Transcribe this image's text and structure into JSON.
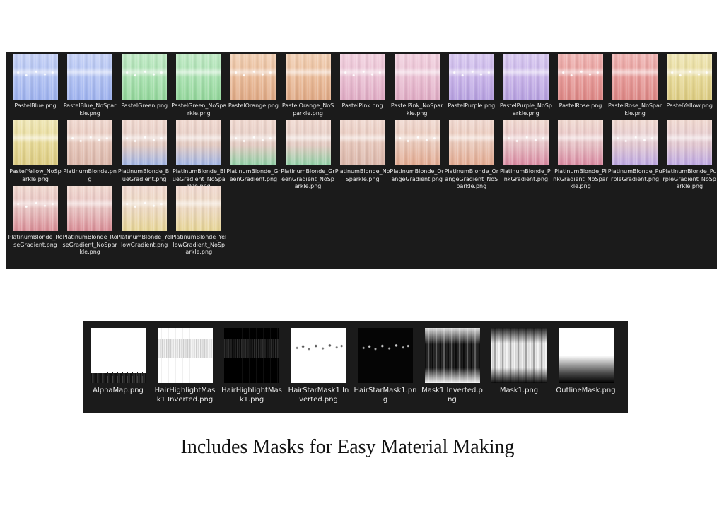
{
  "textures": [
    {
      "label": "PastelBlue.png",
      "colors": [
        "#c5d1f6",
        "#aebff2",
        "#9db1ee"
      ],
      "sparkle": true
    },
    {
      "label": "PastelBlue_NoSparkle.png",
      "colors": [
        "#c5d1f6",
        "#aebff2",
        "#9db1ee"
      ],
      "sparkle": false
    },
    {
      "label": "PastelGreen.png",
      "colors": [
        "#bfe9c4",
        "#a6e0ad",
        "#92d69a"
      ],
      "sparkle": true
    },
    {
      "label": "PastelGreen_NoSparkle.png",
      "colors": [
        "#bfe9c4",
        "#a6e0ad",
        "#92d69a"
      ],
      "sparkle": false
    },
    {
      "label": "PastelOrange.png",
      "colors": [
        "#f1cfb3",
        "#e9b996",
        "#dfa884"
      ],
      "sparkle": true
    },
    {
      "label": "PastelOrange_NoSparkle.png",
      "colors": [
        "#f1cfb3",
        "#e9b996",
        "#dfa884"
      ],
      "sparkle": false
    },
    {
      "label": "PastelPink.png",
      "colors": [
        "#f1d0de",
        "#e9bdd1",
        "#dfaac3"
      ],
      "sparkle": true
    },
    {
      "label": "PastelPink_NoSparkle.png",
      "colors": [
        "#f1d0de",
        "#e9bdd1",
        "#dfaac3"
      ],
      "sparkle": false
    },
    {
      "label": "PastelPurple.png",
      "colors": [
        "#d8c8f0",
        "#c6b1e8",
        "#b59fdf"
      ],
      "sparkle": true
    },
    {
      "label": "PastelPurple_NoSparkle.png",
      "colors": [
        "#d8c8f0",
        "#c6b1e8",
        "#b59fdf"
      ],
      "sparkle": false
    },
    {
      "label": "PastelRose.png",
      "colors": [
        "#efb4b2",
        "#e69896",
        "#dc8684"
      ],
      "sparkle": true
    },
    {
      "label": "PastelRose_NoSparkle.png",
      "colors": [
        "#efb4b2",
        "#e69896",
        "#dc8684"
      ],
      "sparkle": false
    },
    {
      "label": "PastelYellow.png",
      "colors": [
        "#efe6b4",
        "#e6d894",
        "#dccb80"
      ],
      "sparkle": true
    },
    {
      "label": "PastelYellow_NoSparkle.png",
      "colors": [
        "#efe6b4",
        "#e6d894",
        "#dccb80"
      ],
      "sparkle": false
    },
    {
      "label": "PlatinumBlonde.png",
      "colors": [
        "#f0d8cf",
        "#e5c4b8",
        "#dab5a8"
      ],
      "sparkle": true
    },
    {
      "label": "PlatinumBlonde_BlueGradient.png",
      "colors": [
        "#f0d8cf",
        "#e2c9c0",
        "#9fb4e6"
      ],
      "sparkle": true
    },
    {
      "label": "PlatinumBlonde_BlueGradient_NoSparkle.png",
      "colors": [
        "#f0d8cf",
        "#e2c9c0",
        "#9fb4e6"
      ],
      "sparkle": false
    },
    {
      "label": "PlatinumBlonde_GreenGradient.png",
      "colors": [
        "#f0d8cf",
        "#e2c9c0",
        "#8fd0a5"
      ],
      "sparkle": true
    },
    {
      "label": "PlatinumBlonde_GreenGradient_NoSparkle.png",
      "colors": [
        "#f0d8cf",
        "#e2c9c0",
        "#8fd0a5"
      ],
      "sparkle": false
    },
    {
      "label": "PlatinumBlonde_NoSparkle.png",
      "colors": [
        "#f0d8cf",
        "#e5c4b8",
        "#dab5a8"
      ],
      "sparkle": false
    },
    {
      "label": "PlatinumBlonde_OrangeGradient.png",
      "colors": [
        "#f0d8cf",
        "#e8c4b4",
        "#e3a98f"
      ],
      "sparkle": true
    },
    {
      "label": "PlatinumBlonde_OrangeGradient_NoSparkle.png",
      "colors": [
        "#f0d8cf",
        "#e8c4b4",
        "#e3a98f"
      ],
      "sparkle": false
    },
    {
      "label": "PlatinumBlonde_PinkGradient.png",
      "colors": [
        "#f0d8cf",
        "#e5bdc2",
        "#d9879f"
      ],
      "sparkle": true
    },
    {
      "label": "PlatinumBlonde_PinkGradient_NoSparkle.png",
      "colors": [
        "#f0d8cf",
        "#e5bdc2",
        "#d9879f"
      ],
      "sparkle": false
    },
    {
      "label": "PlatinumBlonde_PurpleGradient.png",
      "colors": [
        "#f0d8cf",
        "#e1c6d0",
        "#bba6e3"
      ],
      "sparkle": true
    },
    {
      "label": "PlatinumBlonde_PurpleGradient_NoSparkle.png",
      "colors": [
        "#f0d8cf",
        "#e1c6d0",
        "#bba6e3"
      ],
      "sparkle": false
    },
    {
      "label": "PlatinumBlonde_RoseGradient.png",
      "colors": [
        "#f0d8cf",
        "#e6bcbc",
        "#d98c95"
      ],
      "sparkle": true
    },
    {
      "label": "PlatinumBlonde_RoseGradient_NoSparkle.png",
      "colors": [
        "#f0d8cf",
        "#e6bcbc",
        "#d98c95"
      ],
      "sparkle": false
    },
    {
      "label": "PlatinumBlonde_YellowGradient.png",
      "colors": [
        "#f0d8cf",
        "#ecd8bd",
        "#e6d493"
      ],
      "sparkle": true
    },
    {
      "label": "PlatinumBlonde_YellowGradient_NoSparkle.png",
      "colors": [
        "#f0d8cf",
        "#ecd8bd",
        "#e6d493"
      ],
      "sparkle": false
    }
  ],
  "masks": [
    {
      "label": "AlphaMap.png",
      "style": "alpha"
    },
    {
      "label": "HairHighlightMask1 Inverted.png",
      "style": "hl-inv"
    },
    {
      "label": "HairHighlightMask1.png",
      "style": "hl"
    },
    {
      "label": "HairStarMask1 Inverted.png",
      "style": "star-inv"
    },
    {
      "label": "HairStarMask1.png",
      "style": "star"
    },
    {
      "label": "Mask1 Inverted.png",
      "style": "mask-inv"
    },
    {
      "label": "Mask1.png",
      "style": "mask"
    },
    {
      "label": "OutlineMask.png",
      "style": "outline"
    }
  ],
  "caption": "Includes Masks for Easy Material Making",
  "colors": {
    "panel": "#1b1b1b",
    "label_text": "#e8e8e8",
    "caption_text": "#111111"
  }
}
